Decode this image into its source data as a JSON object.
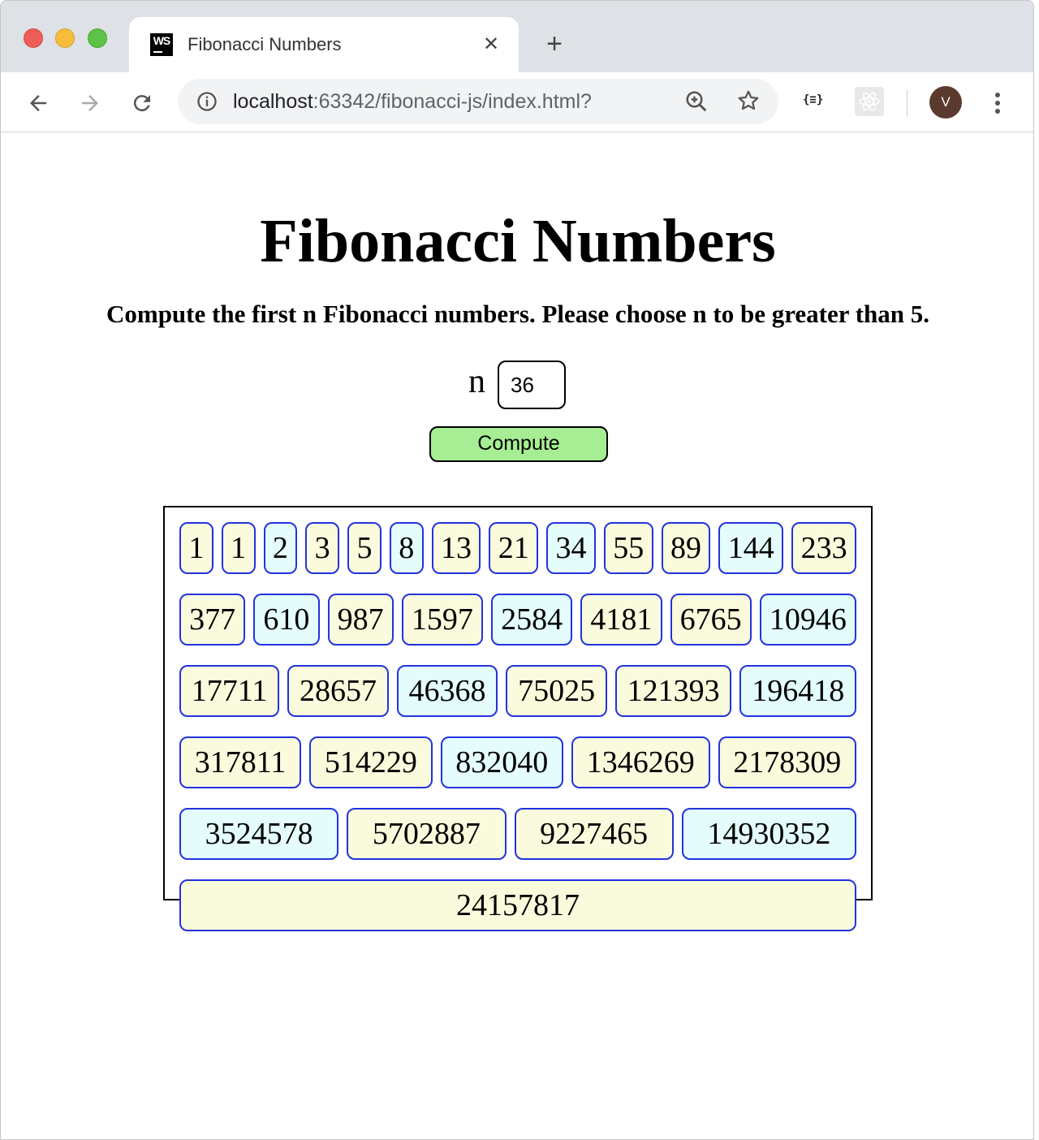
{
  "browser": {
    "tab_title": "Fibonacci Numbers",
    "tab_favicon": "WS",
    "url_host": "localhost",
    "url_rest": ":63342/fibonacci-js/index.html?",
    "extension_json_label": "{≡}",
    "avatar_initial": "V"
  },
  "page": {
    "title": "Fibonacci Numbers",
    "instruction": "Compute the first n Fibonacci numbers. Please choose n to be greater than 5.",
    "n_label": "n",
    "n_value": "36",
    "compute_label": "Compute"
  },
  "colors": {
    "button_fill": "#a6ed94",
    "box_border": "#2233dd",
    "box_yellow": "#fafadc",
    "box_cyan": "#e4fcfc"
  },
  "fibonacci_rows": [
    [
      {
        "value": "1",
        "color": "yellow"
      },
      {
        "value": "1",
        "color": "yellow"
      },
      {
        "value": "2",
        "color": "cyan"
      },
      {
        "value": "3",
        "color": "yellow"
      },
      {
        "value": "5",
        "color": "yellow"
      },
      {
        "value": "8",
        "color": "cyan"
      },
      {
        "value": "13",
        "color": "yellow"
      },
      {
        "value": "21",
        "color": "yellow"
      },
      {
        "value": "34",
        "color": "cyan"
      },
      {
        "value": "55",
        "color": "yellow"
      },
      {
        "value": "89",
        "color": "yellow"
      },
      {
        "value": "144",
        "color": "cyan"
      },
      {
        "value": "233",
        "color": "yellow"
      }
    ],
    [
      {
        "value": "377",
        "color": "yellow"
      },
      {
        "value": "610",
        "color": "cyan"
      },
      {
        "value": "987",
        "color": "yellow"
      },
      {
        "value": "1597",
        "color": "yellow"
      },
      {
        "value": "2584",
        "color": "cyan"
      },
      {
        "value": "4181",
        "color": "yellow"
      },
      {
        "value": "6765",
        "color": "yellow"
      },
      {
        "value": "10946",
        "color": "cyan"
      }
    ],
    [
      {
        "value": "17711",
        "color": "yellow"
      },
      {
        "value": "28657",
        "color": "yellow"
      },
      {
        "value": "46368",
        "color": "cyan"
      },
      {
        "value": "75025",
        "color": "yellow"
      },
      {
        "value": "121393",
        "color": "yellow"
      },
      {
        "value": "196418",
        "color": "cyan"
      }
    ],
    [
      {
        "value": "317811",
        "color": "yellow"
      },
      {
        "value": "514229",
        "color": "yellow"
      },
      {
        "value": "832040",
        "color": "cyan"
      },
      {
        "value": "1346269",
        "color": "yellow"
      },
      {
        "value": "2178309",
        "color": "yellow"
      }
    ],
    [
      {
        "value": "3524578",
        "color": "cyan"
      },
      {
        "value": "5702887",
        "color": "yellow"
      },
      {
        "value": "9227465",
        "color": "yellow"
      },
      {
        "value": "14930352",
        "color": "cyan"
      }
    ],
    [
      {
        "value": "24157817",
        "color": "yellow"
      }
    ]
  ]
}
